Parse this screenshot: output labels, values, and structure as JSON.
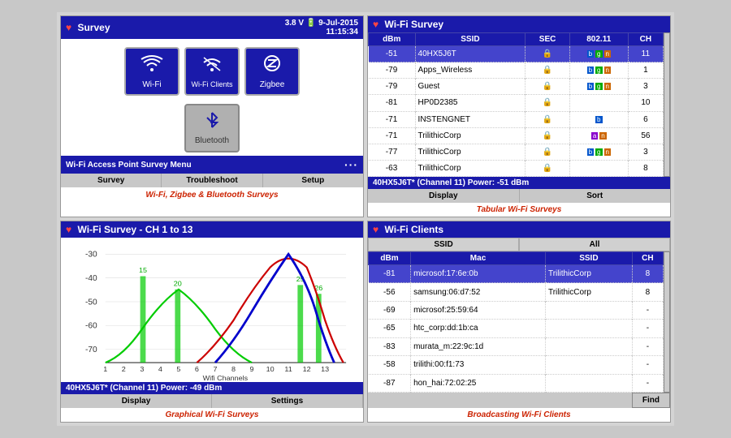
{
  "app": {
    "title": "Survey",
    "battery": "3.8 V",
    "date": "9-Jul-2015",
    "time": "11:15:34"
  },
  "survey_panel": {
    "header": "Survey",
    "buttons": [
      {
        "label": "Wi-Fi",
        "icon": "wifi"
      },
      {
        "label": "Wi-Fi Clients",
        "icon": "wifi-clients"
      },
      {
        "label": "Zigbee",
        "icon": "zigbee"
      }
    ],
    "bluetooth_label": "Bluetooth",
    "access_menu_label": "Wi-Fi Access Point Survey Menu",
    "tabs": [
      "Survey",
      "Troubleshoot",
      "Setup"
    ],
    "caption": "Wi-Fi, Zigbee & Bluetooth Surveys"
  },
  "wifi_survey_panel": {
    "header": "Wi-Fi Survey",
    "columns": [
      "dBm",
      "SSID",
      "SEC",
      "802.11",
      "CH"
    ],
    "rows": [
      {
        "dbm": "-51",
        "ssid": "40HX5J6T",
        "sec": "lock",
        "protocols": [
          "b",
          "g",
          "n"
        ],
        "ch": "11",
        "selected": true
      },
      {
        "dbm": "-79",
        "ssid": "Apps_Wireless",
        "sec": "lock",
        "protocols": [
          "b",
          "g",
          "n"
        ],
        "ch": "1",
        "selected": false
      },
      {
        "dbm": "-79",
        "ssid": "Guest",
        "sec": "lock",
        "protocols": [
          "b",
          "g",
          "n"
        ],
        "ch": "3",
        "selected": false
      },
      {
        "dbm": "-81",
        "ssid": "HP0D2385",
        "sec": "lock",
        "protocols": [],
        "ch": "10",
        "selected": false
      },
      {
        "dbm": "-71",
        "ssid": "INSTENGNET",
        "sec": "lock",
        "protocols": [
          "b"
        ],
        "ch": "6",
        "selected": false
      },
      {
        "dbm": "-71",
        "ssid": "TrilithicCorp",
        "sec": "lock",
        "protocols": [
          "a",
          "n"
        ],
        "ch": "56",
        "selected": false
      },
      {
        "dbm": "-77",
        "ssid": "TrilithicCorp",
        "sec": "lock",
        "protocols": [
          "b",
          "g",
          "n"
        ],
        "ch": "3",
        "selected": false
      },
      {
        "dbm": "-63",
        "ssid": "TrilithicCorp",
        "sec": "lock",
        "protocols": [],
        "ch": "8",
        "selected": false
      }
    ],
    "status_bar": "40HX5J6T* (Channel 11) Power: -51 dBm",
    "bottom_tabs": [
      "Display",
      "Sort"
    ],
    "caption": "Tabular Wi-Fi Surveys"
  },
  "graph_panel": {
    "header": "Wi-Fi Survey - CH 1 to 13",
    "y_labels": [
      "-30",
      "-40",
      "-50",
      "-60",
      "-70"
    ],
    "x_label": "Wifi Channels",
    "x_ticks": [
      "1",
      "2",
      "3",
      "4",
      "5",
      "6",
      "7",
      "8",
      "9",
      "10",
      "11",
      "12",
      "13"
    ],
    "channel_labels": [
      "15",
      "20",
      "25",
      "26"
    ],
    "status_bar": "40HX5J6T* (Channel 11) Power: -49 dBm",
    "bottom_tabs": [
      "Display",
      "Settings"
    ],
    "caption": "Graphical Wi-Fi Surveys"
  },
  "clients_panel": {
    "header": "Wi-Fi Clients",
    "filter_cols": [
      "SSID",
      "All"
    ],
    "columns": [
      "dBm",
      "Mac",
      "SSID",
      "CH"
    ],
    "rows": [
      {
        "dbm": "-81",
        "mac": "microsof:17:6e:0b",
        "ssid": "TrilithicCorp",
        "ch": "8",
        "selected": true
      },
      {
        "dbm": "-56",
        "mac": "samsung:06:d7:52",
        "ssid": "TrilithicCorp",
        "ch": "8",
        "selected": false
      },
      {
        "dbm": "-69",
        "mac": "microsof:25:59:64",
        "ssid": "",
        "ch": "-",
        "selected": false
      },
      {
        "dbm": "-65",
        "mac": "htc_corp:dd:1b:ca",
        "ssid": "",
        "ch": "-",
        "selected": false
      },
      {
        "dbm": "-83",
        "mac": "murata_m:22:9c:1d",
        "ssid": "",
        "ch": "-",
        "selected": false
      },
      {
        "dbm": "-58",
        "mac": "trilithi:00:f1:73",
        "ssid": "",
        "ch": "-",
        "selected": false
      },
      {
        "dbm": "-87",
        "mac": "hon_hai:72:02:25",
        "ssid": "",
        "ch": "-",
        "selected": false
      }
    ],
    "find_label": "Find",
    "caption": "Broadcasting Wi-Fi Clients"
  }
}
